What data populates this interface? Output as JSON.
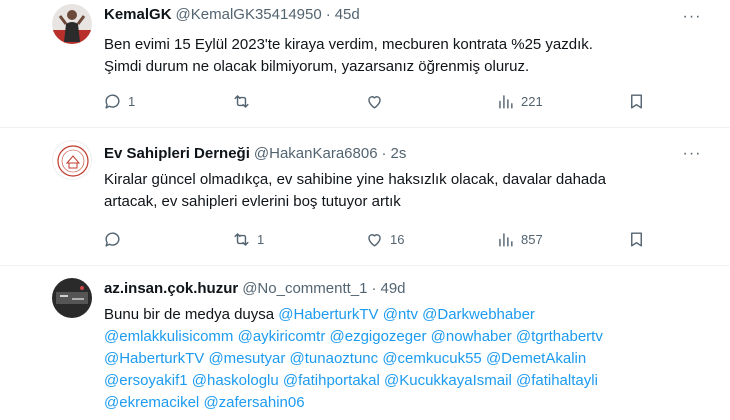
{
  "tweets": [
    {
      "name": "KemalGK",
      "handle": "@KemalGK35414950",
      "separator": "·",
      "time": "45d",
      "text_lines": [
        "Ben evimi 15 Eylül 2023'te kiraya verdim, mecburen kontrata %25 yazdık.",
        "Şimdi durum ne olacak bilmiyorum, yazarsanız öğrenmiş oluruz."
      ],
      "replies": "1",
      "retweets": "",
      "likes": "",
      "views": "221",
      "avatar_icon": "person-photo-icon"
    },
    {
      "name": "Ev Sahipleri Derneği",
      "handle": "@HakanKara6806",
      "separator": "·",
      "time": "2s",
      "text_lines": [
        "Kiralar güncel olmadıkça, ev sahibine yine haksızlık olacak, davalar dahada",
        "artacak, ev sahipleri evlerini boş tutuyor artık"
      ],
      "replies": "",
      "retweets": "1",
      "likes": "16",
      "views": "857",
      "avatar_icon": "association-logo-icon"
    },
    {
      "name": "az.insan.çok.huzur",
      "handle": "@No_commentt_1",
      "separator": "·",
      "time": "49d",
      "intro": "Bunu bir de medya duysa",
      "mentions": [
        [
          "@HaberturkTV",
          "@ntv",
          "@Darkwebhaber"
        ],
        [
          "@emlakkulisicomm",
          "@aykiricomtr",
          "@ezgigozeger",
          "@nowhaber",
          "@tgrthabertv"
        ],
        [
          "@HaberturkTV",
          "@mesutyar",
          "@tunaoztunc",
          "@cemkucuk55",
          "@DemetAkalin"
        ],
        [
          "@ersoyakif1",
          "@haskologlu",
          "@fatihportakal",
          "@KucukkayaIsmail",
          "@fatihaltayli"
        ],
        [
          "@ekremacikel",
          "@zafersahin06"
        ]
      ],
      "avatar_icon": "dark-photo-icon"
    }
  ],
  "colors": {
    "text": "#0f1419",
    "secondary": "#536471",
    "mention": "#1d9bf0",
    "divider": "#eff3f4"
  }
}
